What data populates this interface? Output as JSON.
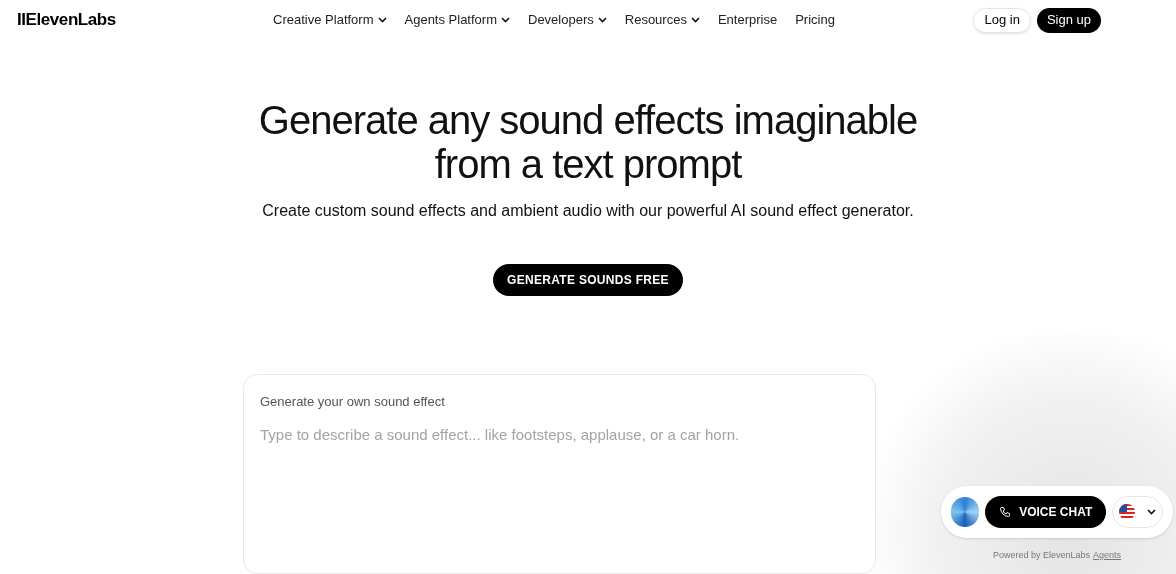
{
  "nav": {
    "logo": "IIElevenLabs",
    "items": [
      {
        "label": "Creative Platform",
        "has_menu": true
      },
      {
        "label": "Agents Platform",
        "has_menu": true
      },
      {
        "label": "Developers",
        "has_menu": true
      },
      {
        "label": "Resources",
        "has_menu": true
      },
      {
        "label": "Enterprise",
        "has_menu": false
      },
      {
        "label": "Pricing",
        "has_menu": false
      }
    ],
    "login": "Log in",
    "signup": "Sign up"
  },
  "hero": {
    "title_lines": [
      "Generate any sound effects imaginable",
      "from a text prompt"
    ],
    "subtitle": "Create custom sound effects and ambient audio with our powerful AI sound effect generator.",
    "cta": "GENERATE SOUNDS FREE"
  },
  "generator": {
    "label": "Generate your own sound effect",
    "placeholder": "Type to describe a sound effect... like footsteps, applause, or a car horn."
  },
  "widget": {
    "button": "VOICE CHAT",
    "powered_by": "Powered by ElevenLabs",
    "link": "Agents"
  }
}
